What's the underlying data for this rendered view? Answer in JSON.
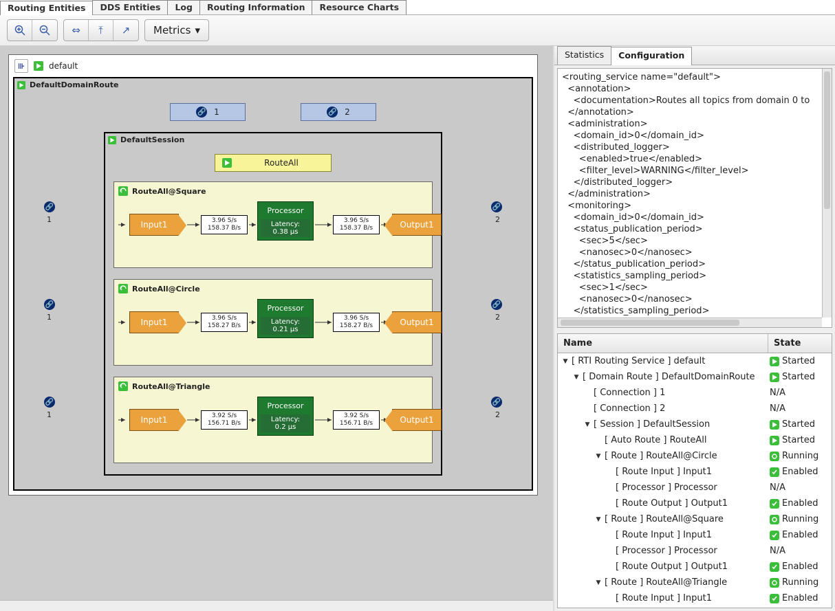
{
  "tabs": [
    "Routing Entities",
    "DDS Entities",
    "Log",
    "Routing Information",
    "Resource Charts"
  ],
  "activeTab": 0,
  "toolbar": {
    "metrics": "Metrics"
  },
  "root": {
    "name": "default"
  },
  "domainRoute": {
    "name": "DefaultDomainRoute"
  },
  "connections": [
    {
      "id": "1"
    },
    {
      "id": "2"
    }
  ],
  "session": {
    "name": "DefaultSession"
  },
  "autoRoute": {
    "name": "RouteAll"
  },
  "routes": [
    {
      "name": "RouteAll@Square",
      "in": "Input1",
      "out": "Output1",
      "proc": "Processor",
      "rate_in_l1": "3.96 S/s",
      "rate_in_l2": "158.37 B/s",
      "rate_out_l1": "3.96 S/s",
      "rate_out_l2": "158.37 B/s",
      "lat_lbl": "Latency:",
      "lat_val": "0.38 µs",
      "leftPort": "1",
      "rightPort": "2"
    },
    {
      "name": "RouteAll@Circle",
      "in": "Input1",
      "out": "Output1",
      "proc": "Processor",
      "rate_in_l1": "3.96 S/s",
      "rate_in_l2": "158.27 B/s",
      "rate_out_l1": "3.96 S/s",
      "rate_out_l2": "158.27 B/s",
      "lat_lbl": "Latency:",
      "lat_val": "0.21 µs",
      "leftPort": "1",
      "rightPort": "2"
    },
    {
      "name": "RouteAll@Triangle",
      "in": "Input1",
      "out": "Output1",
      "proc": "Processor",
      "rate_in_l1": "3.92 S/s",
      "rate_in_l2": "156.71 B/s",
      "rate_out_l1": "3.92 S/s",
      "rate_out_l2": "156.71 B/s",
      "lat_lbl": "Latency:",
      "lat_val": "0.2 µs",
      "leftPort": "1",
      "rightPort": "2"
    }
  ],
  "rightTabs": [
    "Statistics",
    "Configuration"
  ],
  "rightActive": 1,
  "xml": "<routing_service name=\"default\">\n  <annotation>\n    <documentation>Routes all topics from domain 0 to\n  </annotation>\n  <administration>\n    <domain_id>0</domain_id>\n    <distributed_logger>\n      <enabled>true</enabled>\n      <filter_level>WARNING</filter_level>\n    </distributed_logger>\n  </administration>\n  <monitoring>\n    <domain_id>0</domain_id>\n    <status_publication_period>\n      <sec>5</sec>\n      <nanosec>0</nanosec>\n    </status_publication_period>\n    <statistics_sampling_period>\n      <sec>1</sec>\n      <nanosec>0</nanosec>\n    </statistics_sampling_period>\n  </monitoring>",
  "treeHeader": {
    "name": "Name",
    "state": "State"
  },
  "tree": [
    {
      "d": 0,
      "exp": "▼",
      "label": "[ RTI Routing Service ] default",
      "state": "Started",
      "ic": "play"
    },
    {
      "d": 1,
      "exp": "▼",
      "label": "[ Domain Route ] DefaultDomainRoute",
      "state": "Started",
      "ic": "play"
    },
    {
      "d": 2,
      "exp": "",
      "label": "[ Connection ] 1",
      "state": "N/A",
      "ic": ""
    },
    {
      "d": 2,
      "exp": "",
      "label": "[ Connection ] 2",
      "state": "N/A",
      "ic": ""
    },
    {
      "d": 2,
      "exp": "▼",
      "label": "[ Session ] DefaultSession",
      "state": "Started",
      "ic": "play"
    },
    {
      "d": 3,
      "exp": "",
      "label": "[ Auto Route ] RouteAll",
      "state": "Started",
      "ic": "play"
    },
    {
      "d": 3,
      "exp": "▼",
      "label": "[ Route ] RouteAll@Circle",
      "state": "Running",
      "ic": "run"
    },
    {
      "d": 4,
      "exp": "",
      "label": "[ Route Input ] Input1",
      "state": "Enabled",
      "ic": "check"
    },
    {
      "d": 4,
      "exp": "",
      "label": "[ Processor ] Processor",
      "state": "N/A",
      "ic": ""
    },
    {
      "d": 4,
      "exp": "",
      "label": "[ Route Output ] Output1",
      "state": "Enabled",
      "ic": "check"
    },
    {
      "d": 3,
      "exp": "▼",
      "label": "[ Route ] RouteAll@Square",
      "state": "Running",
      "ic": "run"
    },
    {
      "d": 4,
      "exp": "",
      "label": "[ Route Input ] Input1",
      "state": "Enabled",
      "ic": "check"
    },
    {
      "d": 4,
      "exp": "",
      "label": "[ Processor ] Processor",
      "state": "N/A",
      "ic": ""
    },
    {
      "d": 4,
      "exp": "",
      "label": "[ Route Output ] Output1",
      "state": "Enabled",
      "ic": "check"
    },
    {
      "d": 3,
      "exp": "▼",
      "label": "[ Route ] RouteAll@Triangle",
      "state": "Running",
      "ic": "run"
    },
    {
      "d": 4,
      "exp": "",
      "label": "[ Route Input ] Input1",
      "state": "Enabled",
      "ic": "check"
    }
  ]
}
